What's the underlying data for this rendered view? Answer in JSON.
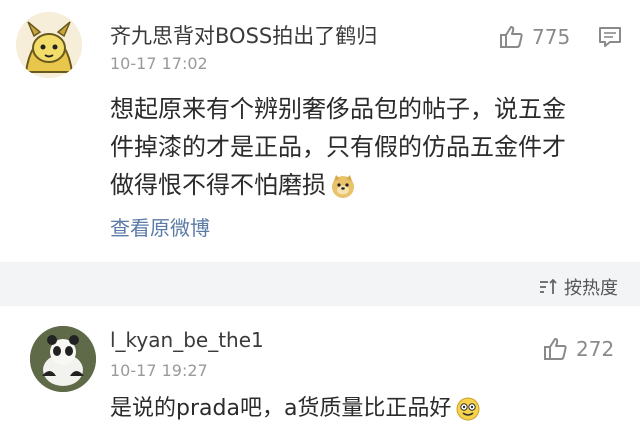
{
  "comments": [
    {
      "username": "齐九思背对BOSS拍出了鹤归",
      "timestamp": "10-17 17:02",
      "likes": "775",
      "text_lines": [
        "想起原来有个辨别奢侈品包的帖子，说五金",
        "件掉漆的才是正品，只有假的仿品五金件才",
        "做得恨不得不怕磨损"
      ],
      "emoji": "doge-emoji",
      "link": "查看原微博"
    },
    {
      "username": "l_kyan_be_the1",
      "timestamp": "10-17 19:27",
      "likes": "272",
      "text": "是说的prada吧，a货质量比正品好",
      "emoji": "laugh-emoji"
    }
  ],
  "sort": {
    "label": "按热度"
  },
  "colors": {
    "link": "#5b7aa6",
    "band": "#f3f4f6",
    "muted": "#9a9a9a"
  }
}
